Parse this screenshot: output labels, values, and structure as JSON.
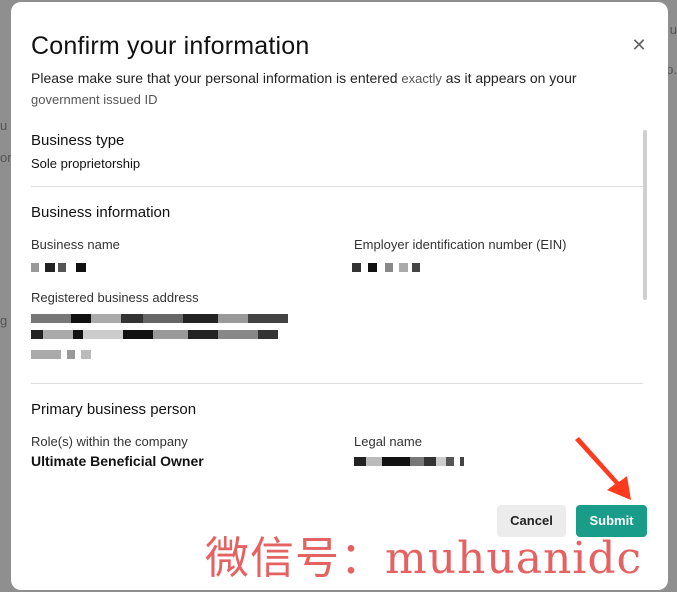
{
  "modal": {
    "title": "Confirm your information",
    "close_icon": "close-icon",
    "subtitle_pre": "Please make sure that your personal information is entered",
    "subtitle_em": "exactly",
    "subtitle_post": "as it appears on your",
    "subtitle_line2": "government issued ID"
  },
  "business_type": {
    "heading": "Business type",
    "value": "Sole proprietorship"
  },
  "business_information": {
    "heading": "Business information",
    "name_label": "Business name",
    "ein_label": "Employer identification number (EIN)",
    "address_label": "Registered business address"
  },
  "primary_person": {
    "heading": "Primary business person",
    "roles_label": "Role(s) within the company",
    "roles_value": "Ultimate Beneficial Owner",
    "legal_name_label": "Legal name"
  },
  "actions": {
    "cancel_label": "Cancel",
    "submit_label": "Submit"
  },
  "watermark": "微信号：muhuanidc",
  "colors": {
    "submit_bg": "#199d8a",
    "arrow": "#ff3b1f",
    "watermark": "#e14646"
  }
}
